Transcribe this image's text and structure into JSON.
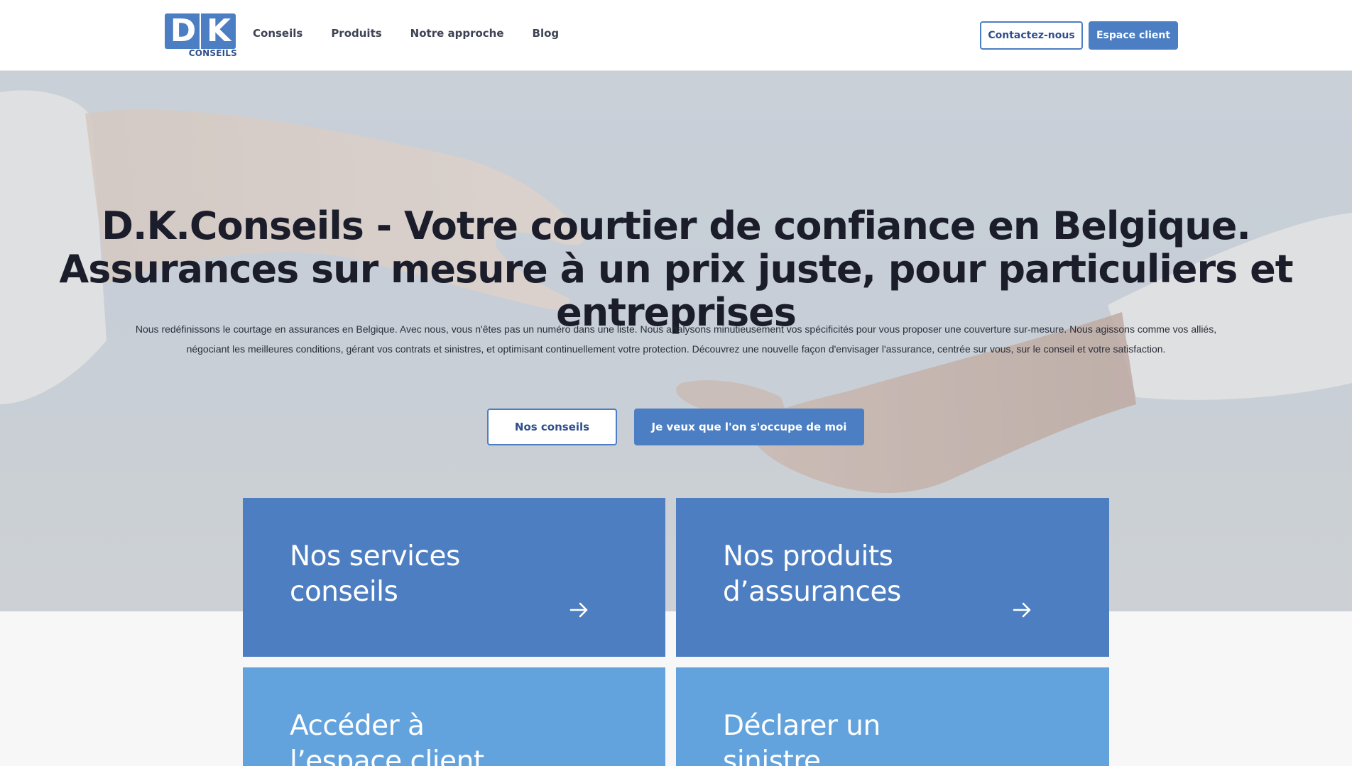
{
  "brand": {
    "logo_letter_1": "D",
    "logo_letter_2": "K",
    "logo_subtitle": "CONSEILS",
    "primary_color": "#4b7ec2",
    "light_color": "#63a3dd"
  },
  "nav": {
    "items": [
      {
        "label": "Conseils"
      },
      {
        "label": "Produits"
      },
      {
        "label": "Notre approche"
      },
      {
        "label": "Blog"
      }
    ],
    "contact_label": "Contactez-nous",
    "espace_label": "Espace client"
  },
  "hero": {
    "title": "D.K.Conseils - Votre courtier de confiance en Belgique. Assurances sur mesure à un prix juste, pour particuliers et entreprises",
    "text": "Nous redéfinissons  le courtage en assurances en Belgique. Avec nous, vous n'êtes pas un numéro dans une liste. Nous analysons minutieusement vos spécificités pour vous proposer une couverture sur-mesure. Nous agissons comme vos alliés, négociant les meilleures conditions, gérant vos contrats et sinistres, et optimisant continuellement votre protection. Découvrez une nouvelle façon d'envisager l'assurance, centrée sur vous, sur le conseil et votre satisfaction.",
    "btn_conseils": "Nos conseils",
    "btn_occupe": "Je veux que l'on s'occupe de moi"
  },
  "cards": [
    {
      "title": "Nos services conseils",
      "icon": "arrow-right-icon"
    },
    {
      "title": "Nos produits d’assurances",
      "icon": "arrow-right-icon"
    },
    {
      "title": "Accéder à l’espace client"
    },
    {
      "title": "Déclarer un sinistre"
    }
  ]
}
